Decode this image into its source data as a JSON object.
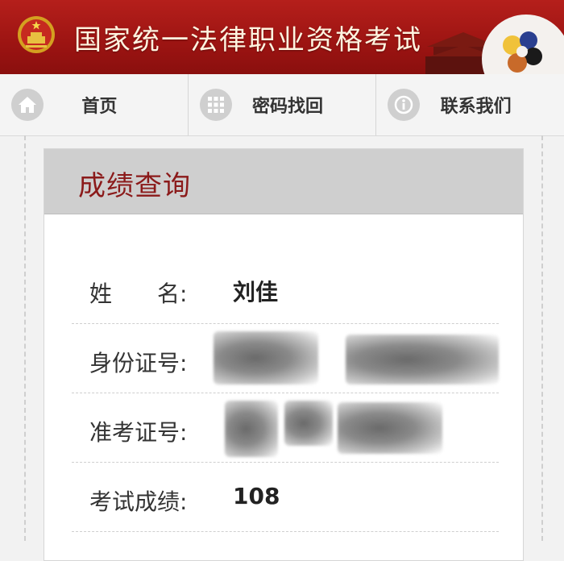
{
  "header": {
    "title": "国家统一法律职业资格考试",
    "brand_color": "#a3171a"
  },
  "nav": {
    "items": [
      {
        "label": "首页",
        "icon": "home-icon"
      },
      {
        "label": "密码找回",
        "icon": "grid-icon"
      },
      {
        "label": "联系我们",
        "icon": "info-icon"
      }
    ]
  },
  "card": {
    "title": "成绩查询",
    "title_color": "#8b1a1a",
    "rows": [
      {
        "label": "姓　　名:",
        "value": "刘佳"
      },
      {
        "label": "身份证号:",
        "value": ""
      },
      {
        "label": "准考证号:",
        "value": ""
      },
      {
        "label": "考试成绩:",
        "value": "108"
      }
    ]
  }
}
